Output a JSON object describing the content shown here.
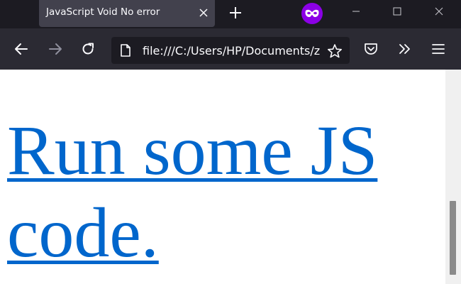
{
  "browser": {
    "tab_title": "JavaScript Void No error",
    "url": "file:///C:/Users/HP/Documents/z",
    "accent_private": "#8b00e6",
    "link_color": "#0066cc"
  },
  "page": {
    "link_text": "Run some JS code."
  },
  "icons": {
    "tab_close": "close-icon",
    "new_tab": "plus-icon",
    "private": "private-browsing-mask-icon",
    "back": "arrow-left-icon",
    "forward": "arrow-right-icon",
    "reload": "reload-icon",
    "page_info": "file-icon",
    "bookmark": "star-icon",
    "pocket": "pocket-icon",
    "overflow": "chevron-double-right-icon",
    "menu": "hamburger-menu-icon"
  }
}
